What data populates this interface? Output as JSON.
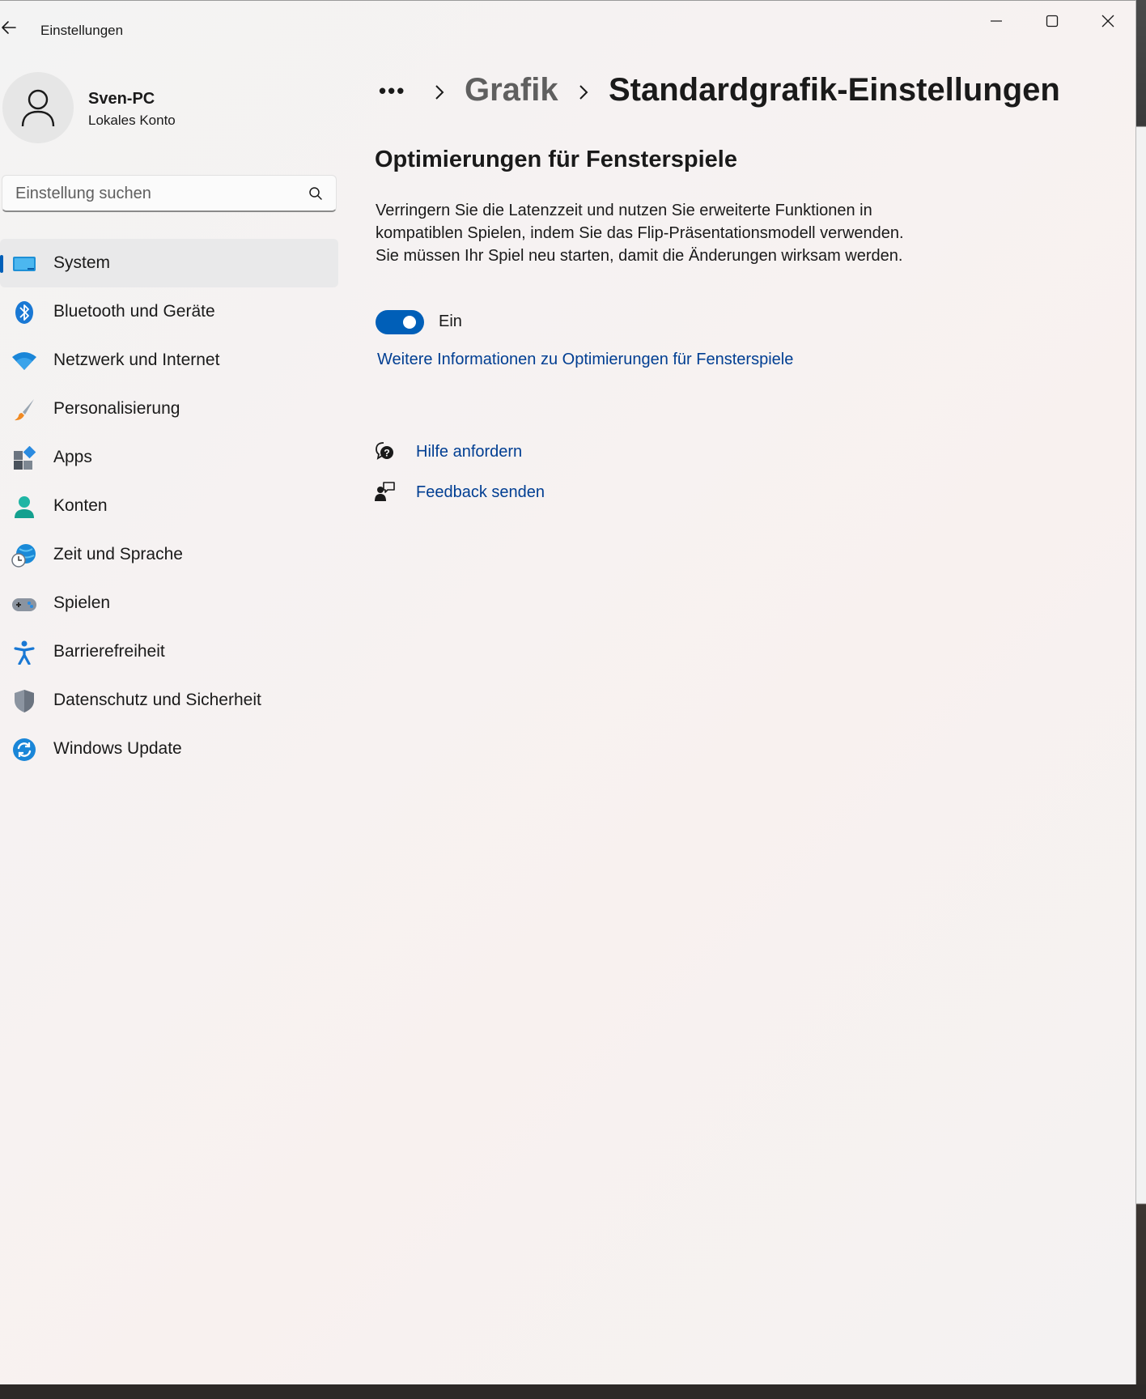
{
  "window": {
    "title": "Einstellungen",
    "controls": [
      "minimize-icon",
      "maximize-icon",
      "close-icon"
    ]
  },
  "profile": {
    "name": "Sven-PC",
    "account_type": "Lokales Konto"
  },
  "search": {
    "placeholder": "Einstellung suchen",
    "value": ""
  },
  "sidebar": {
    "selected": "System",
    "items": [
      {
        "label": "System",
        "icon": "system-icon"
      },
      {
        "label": "Bluetooth und Geräte",
        "icon": "bluetooth-icon"
      },
      {
        "label": "Netzwerk und Internet",
        "icon": "wifi-icon"
      },
      {
        "label": "Personalisierung",
        "icon": "brush-icon"
      },
      {
        "label": "Apps",
        "icon": "apps-icon"
      },
      {
        "label": "Konten",
        "icon": "account-icon"
      },
      {
        "label": "Zeit und Sprache",
        "icon": "globe-clock-icon"
      },
      {
        "label": "Spielen",
        "icon": "gamepad-icon"
      },
      {
        "label": "Barrierefreiheit",
        "icon": "accessibility-icon"
      },
      {
        "label": "Datenschutz und Sicherheit",
        "icon": "shield-icon"
      },
      {
        "label": "Windows Update",
        "icon": "update-icon"
      }
    ]
  },
  "breadcrumb": {
    "more": "•••",
    "parent": "Grafik",
    "current": "Standardgrafik-Einstellungen"
  },
  "main": {
    "section_title": "Optimierungen für Fensterspiele",
    "description": "Verringern Sie die Latenzzeit und nutzen Sie erweiterte Funktionen in kompatiblen Spielen, indem Sie das Flip-Präsentationsmodell verwenden. Sie müssen Ihr Spiel neu starten, damit die Änderungen wirksam werden.",
    "toggle": {
      "state": true,
      "label": "Ein"
    },
    "more_info_link": "Weitere Informationen zu Optimierungen für Fensterspiele",
    "help_links": [
      {
        "label": "Hilfe anfordern",
        "icon": "help-chat-icon"
      },
      {
        "label": "Feedback senden",
        "icon": "feedback-icon"
      }
    ]
  },
  "colors": {
    "accent": "#005fb8",
    "link": "#003e92"
  }
}
